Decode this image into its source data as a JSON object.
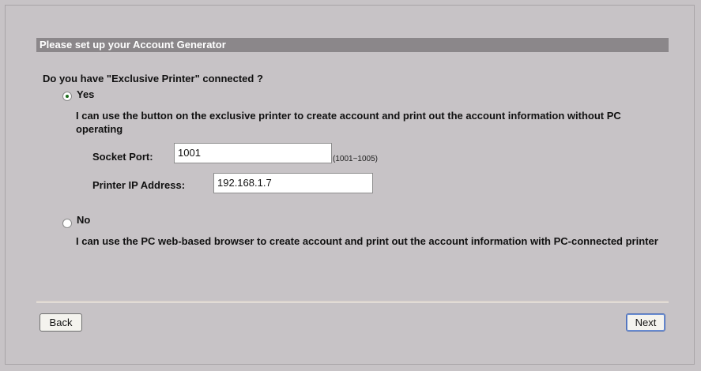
{
  "header": {
    "title": "Please set up your Account Generator"
  },
  "question": "Do you have \"Exclusive Printer\" connected ?",
  "options": [
    {
      "label": "Yes",
      "selected": true,
      "description": "I can use the button on the exclusive printer to create account and print out the account information without PC operating"
    },
    {
      "label": "No",
      "selected": false,
      "description": "I can use the PC web-based browser to create account and print out the account information with PC-connected printer"
    }
  ],
  "fields": {
    "socket_port": {
      "label": "Socket Port:",
      "value": "1001",
      "hint": "(1001~1005)"
    },
    "printer_ip": {
      "label": "Printer IP Address:",
      "value": "192.168.1.7"
    }
  },
  "buttons": {
    "back": "Back",
    "next": "Next"
  },
  "colors": {
    "background": "#c7c3c6",
    "header_bar": "#8b878a",
    "radio_dot": "#1a6b1a"
  }
}
